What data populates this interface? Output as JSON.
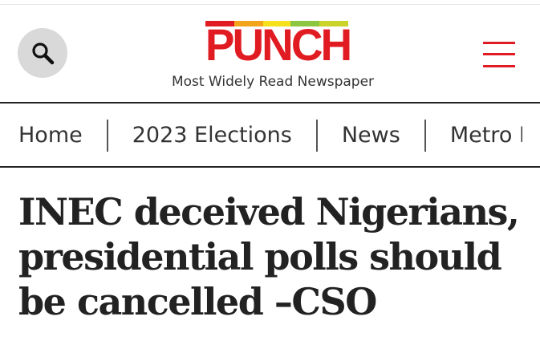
{
  "header": {
    "logo_text": "PUNCH",
    "tagline": "Most Widely Read Newspaper",
    "search_icon": "search-icon",
    "menu_icon": "hamburger-menu-icon",
    "logo_bar_colors": [
      "#e11b22",
      "#f2a51a",
      "#f7e01c",
      "#8dc63f",
      "#c9d32a"
    ],
    "brand_color": "#e11b22"
  },
  "nav": {
    "items": [
      "Home",
      "2023 Elections",
      "News",
      "Metro Plus"
    ]
  },
  "article": {
    "headline": "INEC deceived Nigerians, presidential polls should be cancelled –CSO"
  }
}
